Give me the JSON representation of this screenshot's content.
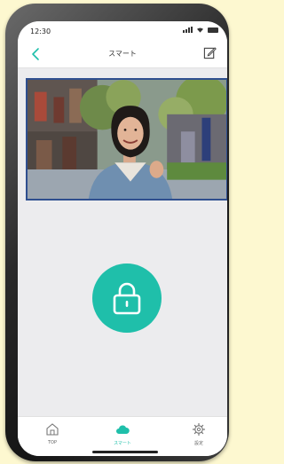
{
  "status_bar": {
    "time": "12:30"
  },
  "header": {
    "title": "スマート",
    "back_icon": "chevron-left-icon",
    "edit_icon": "edit-note-icon"
  },
  "camera": {
    "description_icon": "camera-feed"
  },
  "lock": {
    "icon": "lock-icon",
    "color": "#1fbfaa"
  },
  "tabs": [
    {
      "label": "TOP",
      "icon": "home-icon",
      "active": false
    },
    {
      "label": "スマート",
      "icon": "cloud-icon",
      "active": true
    },
    {
      "label": "設定",
      "icon": "gear-icon",
      "active": false
    }
  ],
  "colors": {
    "accent": "#1fbfaa",
    "frame": "#2f4f8f"
  }
}
